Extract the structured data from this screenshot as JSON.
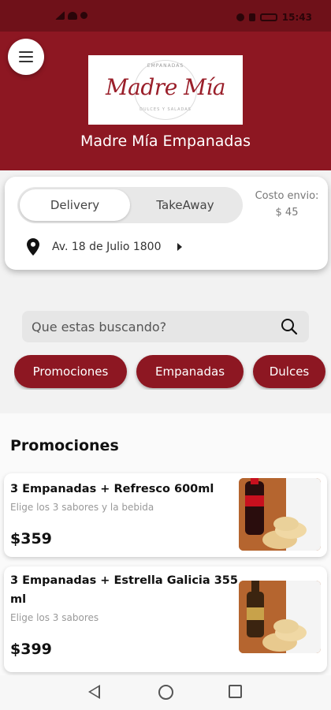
{
  "status_bar": {
    "time": "15:43"
  },
  "header": {
    "brand_small_top": "EMPANADAS",
    "brand_logo_text": "Madre Mía",
    "brand_small_bottom": "DULCES Y SALADAS",
    "store_name": "Madre Mía Empanadas",
    "background_color": "#8d1722"
  },
  "delivery": {
    "options": [
      "Delivery",
      "TakeAway"
    ],
    "selected": "Delivery",
    "cost_label": "Costo envio:",
    "cost_value": "$ 45",
    "address": "Av. 18 de Julio 1800"
  },
  "search": {
    "placeholder": "Que estas buscando?"
  },
  "categories": [
    "Promociones",
    "Empanadas",
    "Dulces"
  ],
  "section": {
    "title": "Promociones",
    "products": [
      {
        "name": "3 Empanadas + Refresco 600ml",
        "description": "Elige los 3 sabores y la bebida",
        "price": "$359",
        "image": "coca-cola-empanadas-photo"
      },
      {
        "name": "3 Empanadas + Estrella Galicia 355 ml",
        "description": "Elige los 3 sabores",
        "price": "$399",
        "image": "beer-empanadas-photo"
      }
    ]
  },
  "colors": {
    "accent": "#8d1722",
    "status_bar": "#6f1119"
  }
}
